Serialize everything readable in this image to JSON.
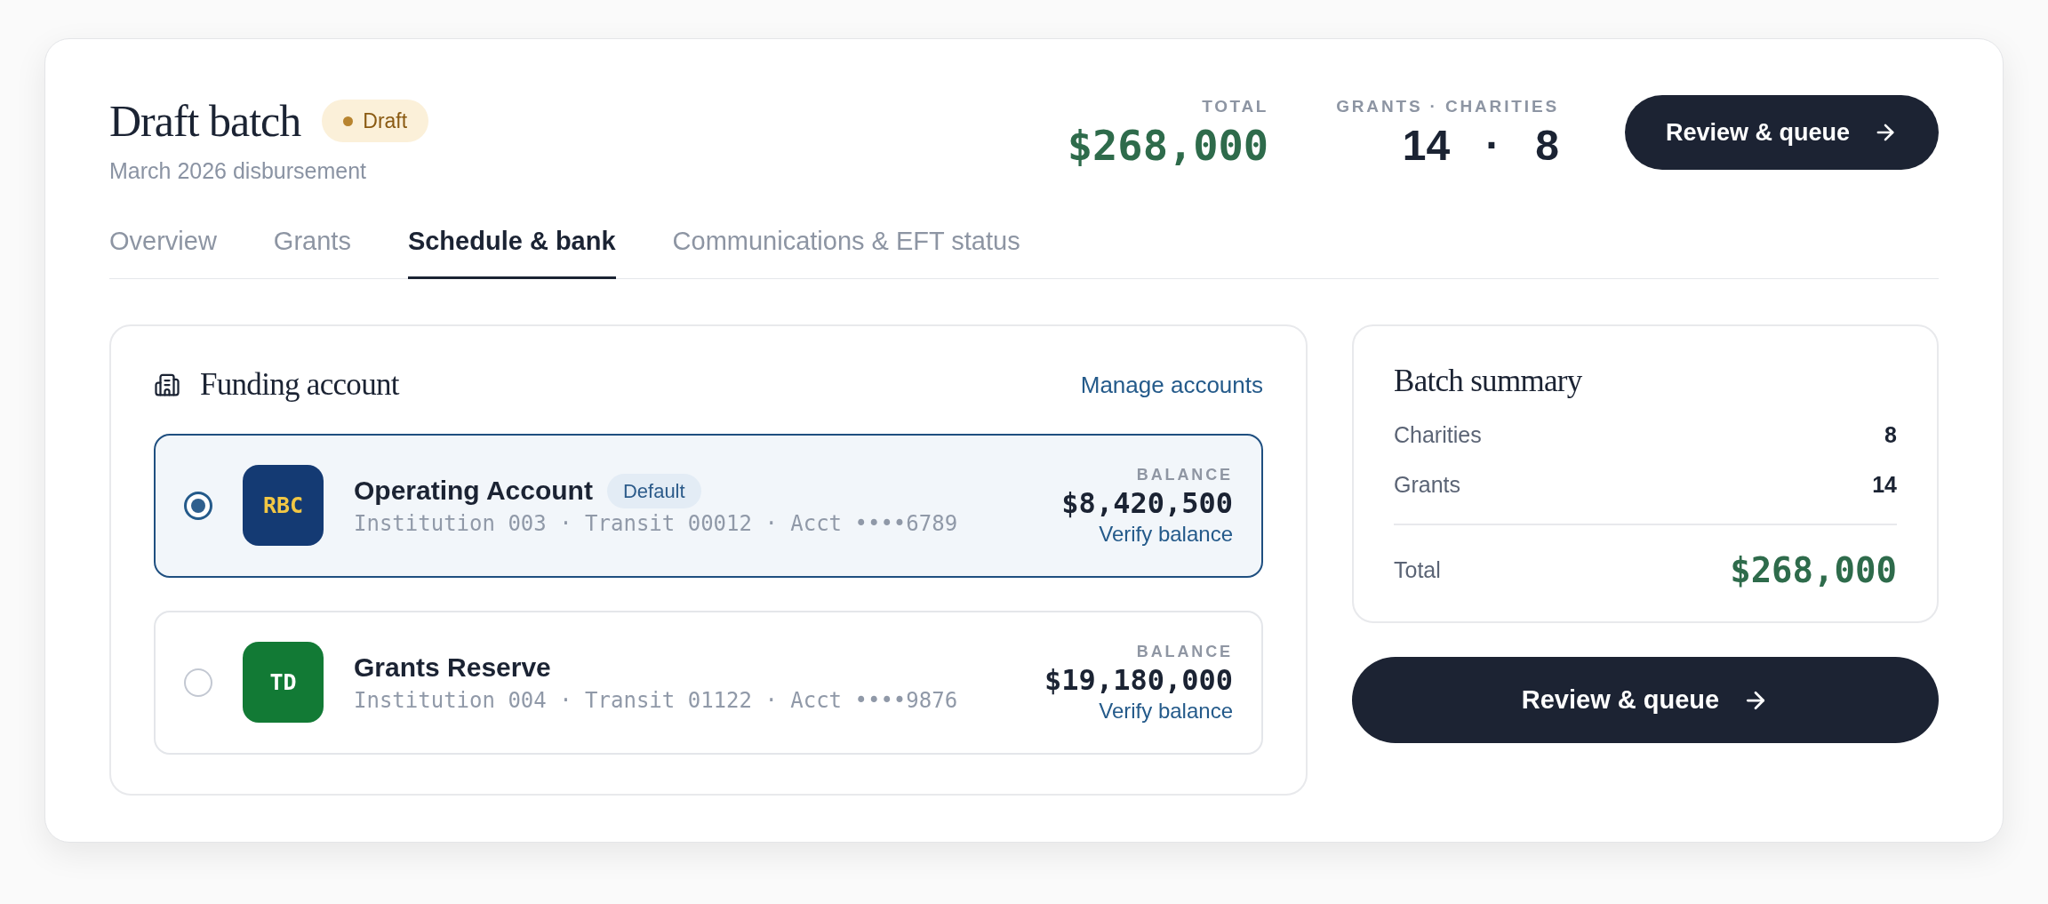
{
  "header": {
    "title": "Draft batch",
    "status": {
      "kind": "draft",
      "label": "Draft"
    },
    "subtitle": "March 2026 disbursement",
    "total": {
      "label": "TOTAL",
      "value": "$268,000"
    },
    "counts": {
      "label": "GRANTS · CHARITIES",
      "grants": "14",
      "separator": "·",
      "charities": "8"
    },
    "button": "Review & queue"
  },
  "tabs": [
    {
      "label": "Overview",
      "selected": false
    },
    {
      "label": "Grants",
      "selected": false
    },
    {
      "label": "Schedule & bank",
      "selected": true
    },
    {
      "label": "Communications & EFT status",
      "selected": false
    }
  ],
  "funding_account": {
    "title": "Funding account",
    "link": "Manage accounts",
    "accounts": [
      {
        "logo": {
          "color": "#143a73",
          "label": {
            "text": "RBC",
            "color": "#f2c744"
          }
        },
        "name": "Operating Account",
        "badge": "Default",
        "details": "Institution 003 · Transit 00012 · Acct ••••6789",
        "balance_label": "BALANCE",
        "balance": "$8,420,500",
        "link": "Verify balance",
        "selected": true
      },
      {
        "logo": {
          "color": "#127a35",
          "label": {
            "text": "TD",
            "color": "#ffffff"
          }
        },
        "name": "Grants Reserve",
        "details": "Institution 004 · Transit 01122 · Acct ••••9876",
        "balance_label": "BALANCE",
        "balance": "$19,180,000",
        "link": "Verify balance",
        "selected": false
      }
    ]
  },
  "batch_summary": {
    "title": "Batch summary",
    "rows": [
      {
        "label": "Charities",
        "value": "8"
      },
      {
        "label": "Grants",
        "value": "14"
      }
    ],
    "total": {
      "label": "Total",
      "value": "$268,000"
    },
    "button": "Review & queue"
  }
}
